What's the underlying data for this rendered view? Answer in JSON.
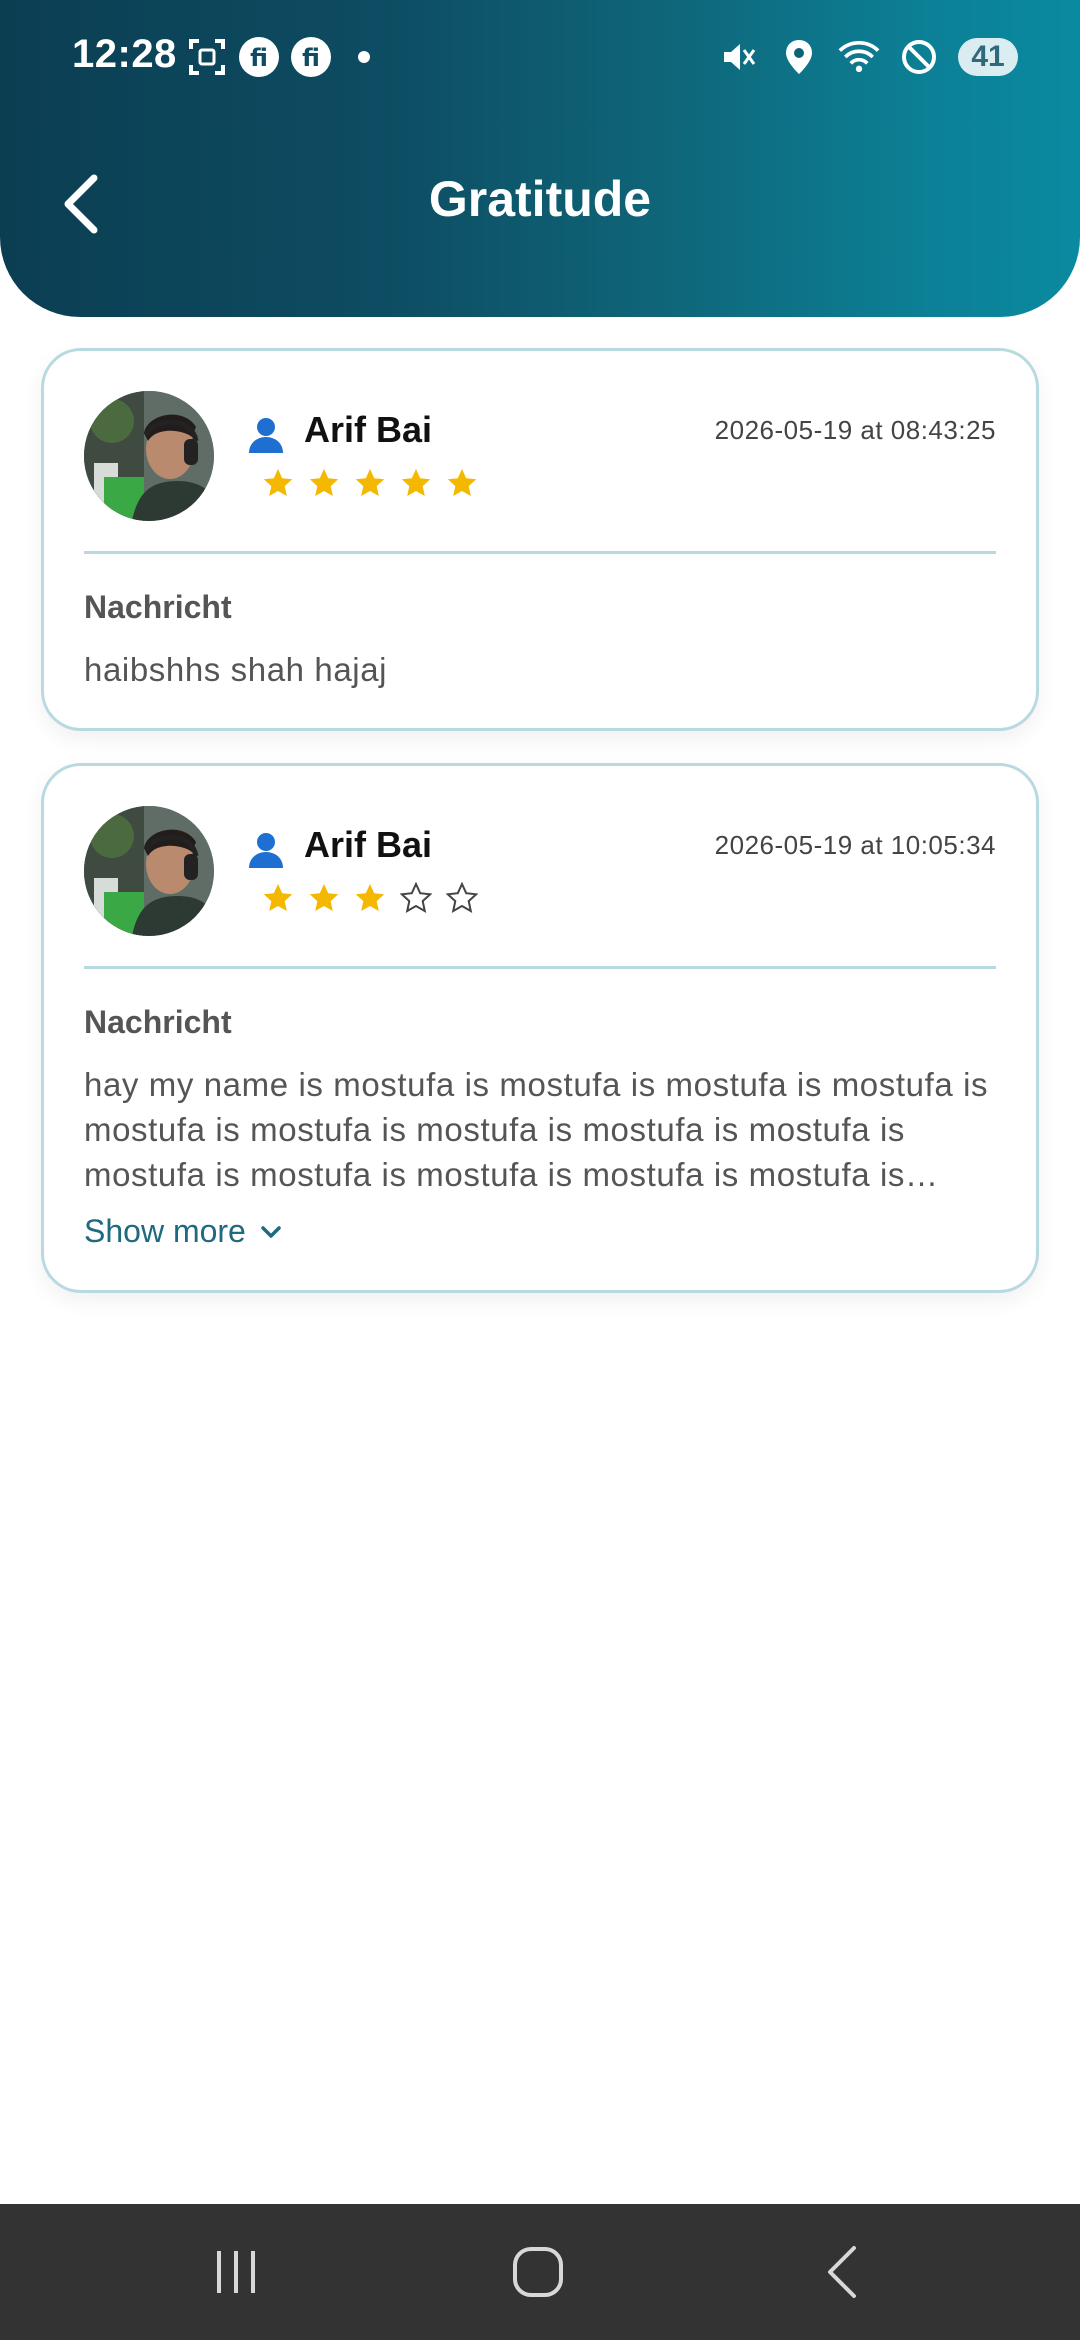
{
  "status_bar": {
    "time": "12:28",
    "battery": "41",
    "icons_left": [
      "screenshot-icon",
      "app-notification-icon",
      "app-notification-icon"
    ],
    "icons_right": [
      "mute-icon",
      "location-icon",
      "wifi-icon",
      "do-not-disturb-icon"
    ]
  },
  "header": {
    "title": "Gratitude",
    "gradient_colors": [
      "#0c3e52",
      "#0a8aa0"
    ]
  },
  "entries": [
    {
      "user_name": "Arif Bai",
      "date": "2026-05-19 at 08:43:25",
      "rating": 5,
      "max_rating": 5,
      "message_label": "Nachricht",
      "message": "haibshhs shah hajaj"
    },
    {
      "user_name": "Arif Bai",
      "date": "2026-05-19 at 10:05:34",
      "rating": 3,
      "max_rating": 5,
      "message_label": "Nachricht",
      "message": "hay my name is mostufa is mostufa is mostufa is mostufa is mostufa is mostufa is mostufa is mostufa is mostufa is mostufa is mostufa is mostufa is mostufa is mostufa is mostufa is mostufa",
      "show_more_label": "Show more"
    }
  ],
  "colors": {
    "accent": "#1f6a7f",
    "star_filled": "#f5b800",
    "card_border": "#b9d9e1",
    "user_icon": "#1e6fd0"
  },
  "nav": {
    "items": [
      "recent-apps-icon",
      "home-icon",
      "back-icon"
    ]
  }
}
